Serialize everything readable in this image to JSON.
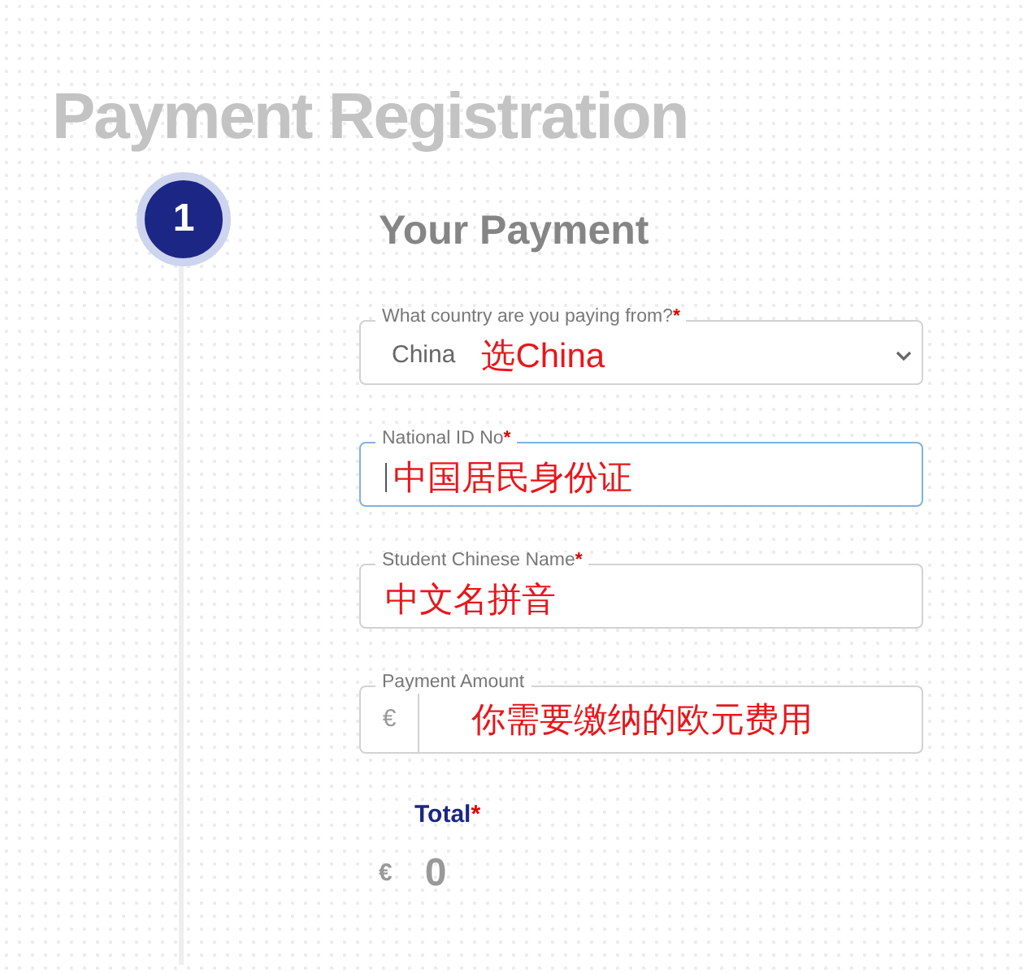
{
  "page_title": "Payment Registration",
  "step": {
    "number": "1",
    "active": true
  },
  "section_title": "Your Payment",
  "fields": [
    {
      "kind": "select",
      "label": "What country are you paying from?",
      "required_mark": "*",
      "value": "China",
      "annotation": "选China",
      "focused": false
    },
    {
      "kind": "text",
      "label": "National ID No",
      "required_mark": "*",
      "annotation": "中国居民身份证",
      "focused": true
    },
    {
      "kind": "text",
      "label": "Student Chinese Name",
      "required_mark": "*",
      "annotation": "中文名拼音",
      "focused": false
    },
    {
      "kind": "currency",
      "label": "Payment Amount",
      "prefix": "€",
      "annotation": "你需要缴纳的欧元费用",
      "focused": false
    }
  ],
  "total": {
    "label": "Total",
    "required_mark": "*",
    "currency": "€",
    "value": "0"
  }
}
